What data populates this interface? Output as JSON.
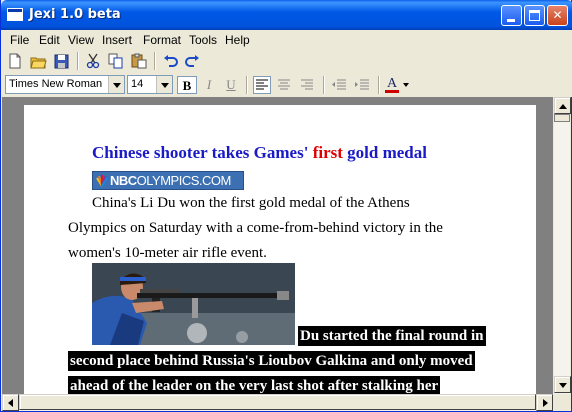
{
  "window": {
    "title": "Jexi 1.0 beta"
  },
  "menu": [
    {
      "label": "File"
    },
    {
      "label": "Edit"
    },
    {
      "label": "View"
    },
    {
      "label": "Insert"
    },
    {
      "label": "Format"
    },
    {
      "label": "Tools"
    },
    {
      "label": "Help"
    }
  ],
  "toolbar": {
    "icons": [
      "new-document-icon",
      "open-folder-icon",
      "save-disk-icon",
      "cut-scissors-icon",
      "copy-icon",
      "paste-icon",
      "undo-icon",
      "redo-icon"
    ]
  },
  "format": {
    "font_family": "Times New Roman",
    "font_size": "14",
    "bold": "B",
    "italic": "I",
    "underline": "U",
    "font_color_label": "A",
    "font_color": "#cc0000"
  },
  "document": {
    "headline_part1": "Chinese shooter takes Games'",
    "headline_red": "first",
    "headline_part2": "gold medal",
    "logo_text_bold": "NBC",
    "logo_text": "OLYMPICS.COM",
    "para1_line1": "China's Li Du won the first gold medal of the Athens",
    "para1_line2": "Olympics on Saturday with a come-from-behind victory in the",
    "para1_line3": "women's 10-meter air rifle event.",
    "para2_line1": "Du started the final round in",
    "para2_line2": "second place behind Russia's Lioubov Galkina and only moved",
    "para2_line3": "ahead of the leader on the very last shot after stalking her",
    "colors": {
      "headline": "#1a1ac8",
      "headline_accent": "#e00000",
      "selection_bg": "#000000"
    }
  }
}
